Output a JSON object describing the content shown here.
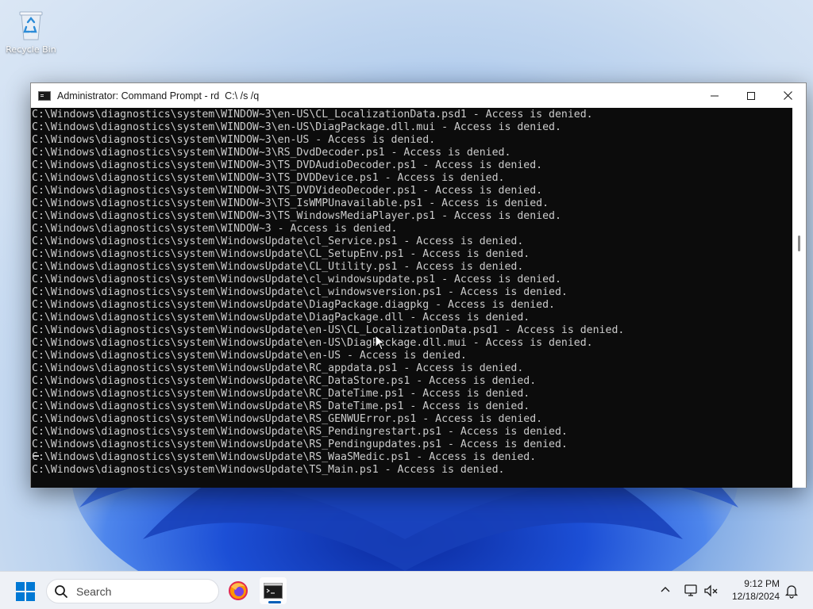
{
  "desktop": {
    "icons": [
      {
        "label": "Recycle Bin",
        "icon": "recycle-bin-icon"
      }
    ]
  },
  "window": {
    "title": "Administrator: Command Prompt - rd  C:\\ /s /q",
    "icon": "command-prompt-icon",
    "controls": {
      "minimize": "minimize-icon",
      "maximize": "maximize-icon",
      "close": "close-icon"
    }
  },
  "console": {
    "lines": [
      "C:\\Windows\\diagnostics\\system\\WINDOW~3\\en-US\\CL_LocalizationData.psd1 - Access is denied.",
      "C:\\Windows\\diagnostics\\system\\WINDOW~3\\en-US\\DiagPackage.dll.mui - Access is denied.",
      "C:\\Windows\\diagnostics\\system\\WINDOW~3\\en-US - Access is denied.",
      "C:\\Windows\\diagnostics\\system\\WINDOW~3\\RS_DvdDecoder.ps1 - Access is denied.",
      "C:\\Windows\\diagnostics\\system\\WINDOW~3\\TS_DVDAudioDecoder.ps1 - Access is denied.",
      "C:\\Windows\\diagnostics\\system\\WINDOW~3\\TS_DVDDevice.ps1 - Access is denied.",
      "C:\\Windows\\diagnostics\\system\\WINDOW~3\\TS_DVDVideoDecoder.ps1 - Access is denied.",
      "C:\\Windows\\diagnostics\\system\\WINDOW~3\\TS_IsWMPUnavailable.ps1 - Access is denied.",
      "C:\\Windows\\diagnostics\\system\\WINDOW~3\\TS_WindowsMediaPlayer.ps1 - Access is denied.",
      "C:\\Windows\\diagnostics\\system\\WINDOW~3 - Access is denied.",
      "C:\\Windows\\diagnostics\\system\\WindowsUpdate\\cl_Service.ps1 - Access is denied.",
      "C:\\Windows\\diagnostics\\system\\WindowsUpdate\\CL_SetupEnv.ps1 - Access is denied.",
      "C:\\Windows\\diagnostics\\system\\WindowsUpdate\\CL_Utility.ps1 - Access is denied.",
      "C:\\Windows\\diagnostics\\system\\WindowsUpdate\\cl_windowsupdate.ps1 - Access is denied.",
      "C:\\Windows\\diagnostics\\system\\WindowsUpdate\\cl_windowsversion.ps1 - Access is denied.",
      "C:\\Windows\\diagnostics\\system\\WindowsUpdate\\DiagPackage.diagpkg - Access is denied.",
      "C:\\Windows\\diagnostics\\system\\WindowsUpdate\\DiagPackage.dll - Access is denied.",
      "C:\\Windows\\diagnostics\\system\\WindowsUpdate\\en-US\\CL_LocalizationData.psd1 - Access is denied.",
      "C:\\Windows\\diagnostics\\system\\WindowsUpdate\\en-US\\DiagPackage.dll.mui - Access is denied.",
      "C:\\Windows\\diagnostics\\system\\WindowsUpdate\\en-US - Access is denied.",
      "C:\\Windows\\diagnostics\\system\\WindowsUpdate\\RC_appdata.ps1 - Access is denied.",
      "C:\\Windows\\diagnostics\\system\\WindowsUpdate\\RC_DataStore.ps1 - Access is denied.",
      "C:\\Windows\\diagnostics\\system\\WindowsUpdate\\RC_DateTime.ps1 - Access is denied.",
      "C:\\Windows\\diagnostics\\system\\WindowsUpdate\\RS_DateTime.ps1 - Access is denied.",
      "C:\\Windows\\diagnostics\\system\\WindowsUpdate\\RS_GENWUError.ps1 - Access is denied.",
      "C:\\Windows\\diagnostics\\system\\WindowsUpdate\\RS_Pendingrestart.ps1 - Access is denied.",
      "C:\\Windows\\diagnostics\\system\\WindowsUpdate\\RS_Pendingupdates.ps1 - Access is denied.",
      "C:\\Windows\\diagnostics\\system\\WindowsUpdate\\RS_WaaSMedic.ps1 - Access is denied.",
      "C:\\Windows\\diagnostics\\system\\WindowsUpdate\\TS_Main.ps1 - Access is denied."
    ]
  },
  "taskbar": {
    "search_placeholder": "Search",
    "apps": [
      {
        "name": "firefox",
        "icon": "firefox-icon"
      },
      {
        "name": "command-prompt",
        "icon": "command-prompt-icon",
        "active": true
      }
    ],
    "tray": {
      "icons": [
        "chevron-up-icon",
        "network-icon",
        "volume-muted-icon"
      ],
      "time": "9:12 PM",
      "date": "12/18/2024",
      "notification_icon": "bell-icon"
    }
  },
  "colors": {
    "console_bg": "#0c0c0c",
    "console_fg": "#cccccc",
    "accent": "#005fb8"
  }
}
